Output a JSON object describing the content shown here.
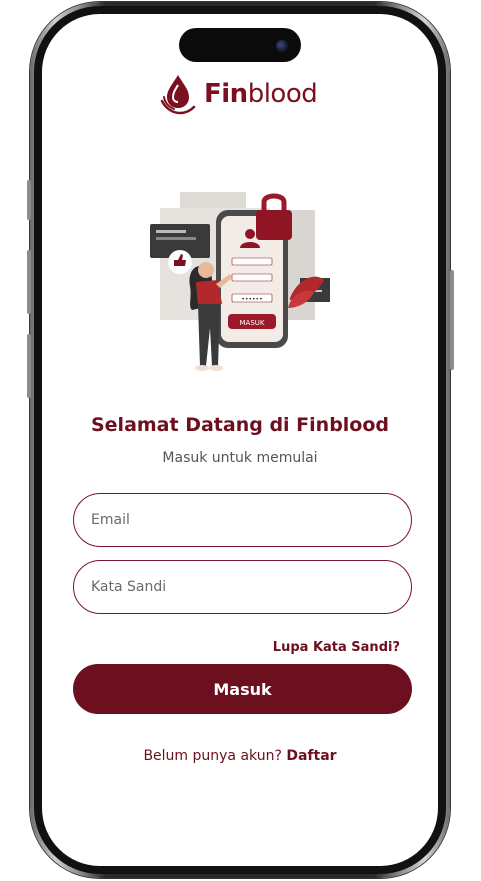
{
  "app": {
    "name_bold": "Fin",
    "name_rest": "blood",
    "logo_icon": "blood-drop-hand-icon"
  },
  "illustration": {
    "button_text": "MASUK",
    "password_mask": "••••••"
  },
  "login": {
    "title": "Selamat Datang di Finblood",
    "subtitle": "Masuk untuk memulai",
    "email_placeholder": "Email",
    "password_placeholder": "Kata Sandi",
    "forgot_label": "Lupa Kata Sandi?",
    "submit_label": "Masuk",
    "register_prompt": "Belum punya akun?",
    "register_link": "Daftar"
  },
  "colors": {
    "brand": "#6c1020",
    "field_border": "#7a1530",
    "background": "#ffffff"
  }
}
